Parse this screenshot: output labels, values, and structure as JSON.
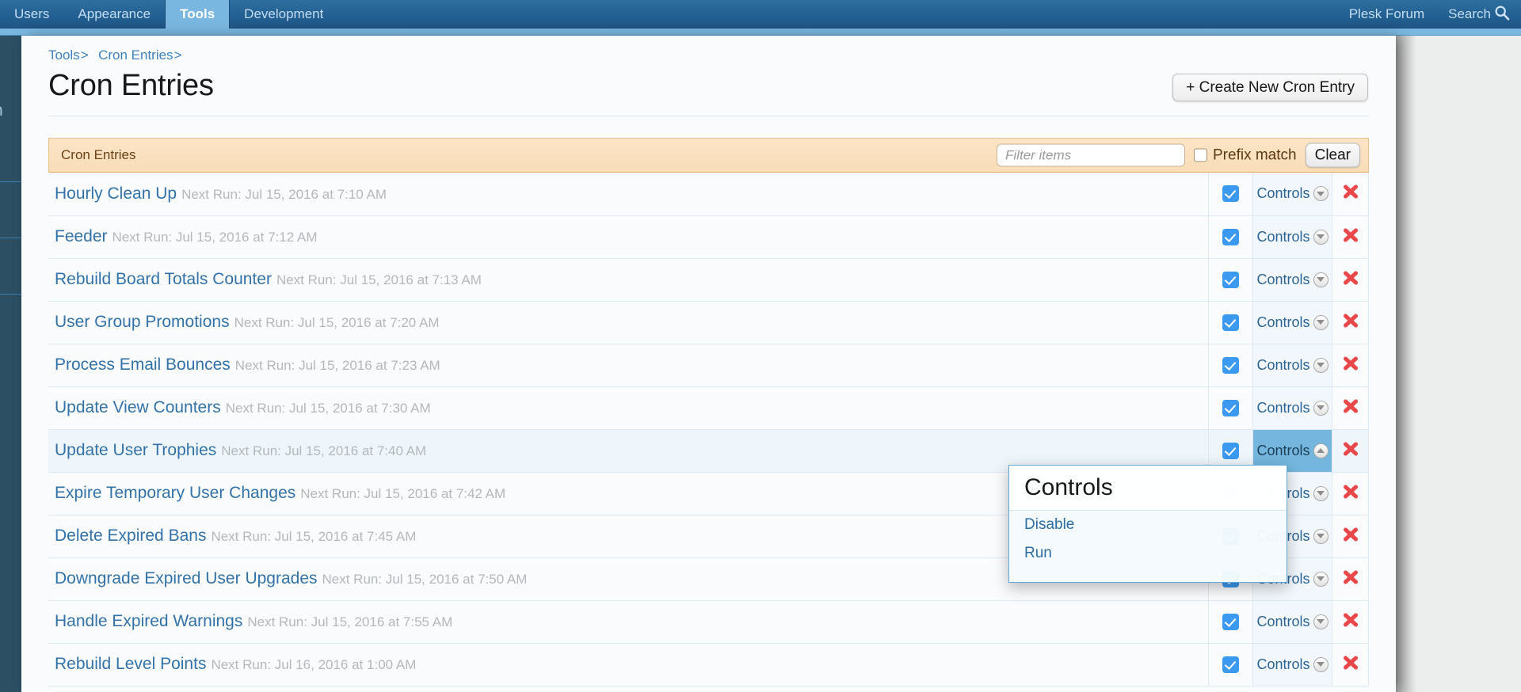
{
  "nav": {
    "items": [
      {
        "label": "Users",
        "active": false
      },
      {
        "label": "Appearance",
        "active": false
      },
      {
        "label": "Tools",
        "active": true
      },
      {
        "label": "Development",
        "active": false
      }
    ],
    "forum_label": "Plesk Forum",
    "search_label": "Search",
    "search_icon": "search-icon"
  },
  "breadcrumb": {
    "item1": "Tools",
    "sep1": ">",
    "item2": "Cron Entries",
    "sep2": ">"
  },
  "header": {
    "title": "Cron Entries",
    "create_button": "+ Create New Cron Entry"
  },
  "filterbar": {
    "section_title": "Cron Entries",
    "filter_placeholder": "Filter items",
    "filter_value": "",
    "prefix_label": "Prefix match",
    "prefix_checked": false,
    "clear_button": "Clear"
  },
  "table": {
    "controls_label": "Controls",
    "next_run_prefix": "Next Run: ",
    "rows": [
      {
        "name": "Hourly Clean Up",
        "next_run": "Next Run: Jul 15, 2016 at 7:10 AM",
        "enabled": true,
        "open": false
      },
      {
        "name": "Feeder",
        "next_run": "Next Run: Jul 15, 2016 at 7:12 AM",
        "enabled": true,
        "open": false
      },
      {
        "name": "Rebuild Board Totals Counter",
        "next_run": "Next Run: Jul 15, 2016 at 7:13 AM",
        "enabled": true,
        "open": false
      },
      {
        "name": "User Group Promotions",
        "next_run": "Next Run: Jul 15, 2016 at 7:20 AM",
        "enabled": true,
        "open": false
      },
      {
        "name": "Process Email Bounces",
        "next_run": "Next Run: Jul 15, 2016 at 7:23 AM",
        "enabled": true,
        "open": false
      },
      {
        "name": "Update View Counters",
        "next_run": "Next Run: Jul 15, 2016 at 7:30 AM",
        "enabled": true,
        "open": false
      },
      {
        "name": "Update User Trophies",
        "next_run": "Next Run: Jul 15, 2016 at 7:40 AM",
        "enabled": true,
        "open": true
      },
      {
        "name": "Expire Temporary User Changes",
        "next_run": "Next Run: Jul 15, 2016 at 7:42 AM",
        "enabled": true,
        "open": false
      },
      {
        "name": "Delete Expired Bans",
        "next_run": "Next Run: Jul 15, 2016 at 7:45 AM",
        "enabled": true,
        "open": false
      },
      {
        "name": "Downgrade Expired User Upgrades",
        "next_run": "Next Run: Jul 15, 2016 at 7:50 AM",
        "enabled": true,
        "open": false
      },
      {
        "name": "Handle Expired Warnings",
        "next_run": "Next Run: Jul 15, 2016 at 7:55 AM",
        "enabled": true,
        "open": false
      },
      {
        "name": "Rebuild Level Points",
        "next_run": "Next Run: Jul 16, 2016 at 1:00 AM",
        "enabled": true,
        "open": false
      }
    ]
  },
  "controls_popup": {
    "title": "Controls",
    "items": [
      "Disable",
      "Run"
    ]
  },
  "colors": {
    "nav_blue": "#236093",
    "nav_active": "#7ab7e0",
    "link_blue": "#3372a8",
    "filter_bg": "#f9ddb8",
    "checkbox_blue": "#3b99f0",
    "delete_red": "#e8484a"
  }
}
